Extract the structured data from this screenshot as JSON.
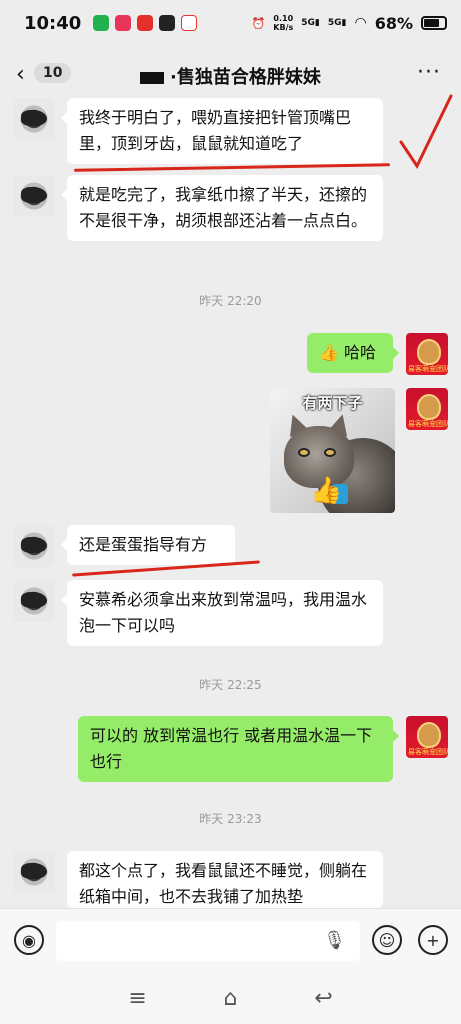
{
  "status_bar": {
    "time": "10:40",
    "net_speed": "0.10",
    "net_unit": "KB/s",
    "sig1": "5G",
    "sig2": "5G",
    "battery": "68%"
  },
  "header": {
    "unread_count": "10",
    "title": "·售独苗合格胖妹妹"
  },
  "messages": [
    {
      "side": "left",
      "text": "我终于明白了，喂奶直接把针管顶嘴巴里，顶到牙齿，鼠鼠就知道吃了"
    },
    {
      "side": "left",
      "text": "就是吃完了，我拿纸巾擦了半天，还擦的不是很干净，胡须根部还沾着一点点白。"
    },
    {
      "type": "timestamp",
      "text": "昨天 22:20"
    },
    {
      "side": "right",
      "emoji": "👍",
      "text": "哈哈"
    },
    {
      "side": "right",
      "type": "sticker",
      "caption": "有两下子"
    },
    {
      "side": "left",
      "text": "还是蛋蛋指导有方"
    },
    {
      "side": "left",
      "text": "安慕希必须拿出来放到常温吗，我用温水泡一下可以吗"
    },
    {
      "type": "timestamp",
      "text": "昨天 22:25"
    },
    {
      "side": "right",
      "text": "可以的 放到常温也行 或者用温水温一下也行"
    },
    {
      "type": "timestamp",
      "text": "昨天 23:23"
    },
    {
      "side": "left",
      "text": "都这个点了，我看鼠鼠还不睡觉，侧躺在纸箱中间，也不去我铺了加热垫"
    }
  ],
  "avatar_right_label": "易客萌宠团队",
  "icons": {
    "back": "chevron-left-icon",
    "more": "more-dots-icon",
    "voice": "voice-icon",
    "mic": "mic-icon",
    "emoji": "emoji-icon",
    "plus": "plus-icon",
    "menu": "menu-icon",
    "home": "home-icon",
    "back_nav": "back-nav-icon"
  },
  "colors": {
    "chat_bg": "#EDEDED",
    "sent_bubble": "#95EC69",
    "received_bubble": "#FFFFFF",
    "annotation": "#D8261C"
  }
}
